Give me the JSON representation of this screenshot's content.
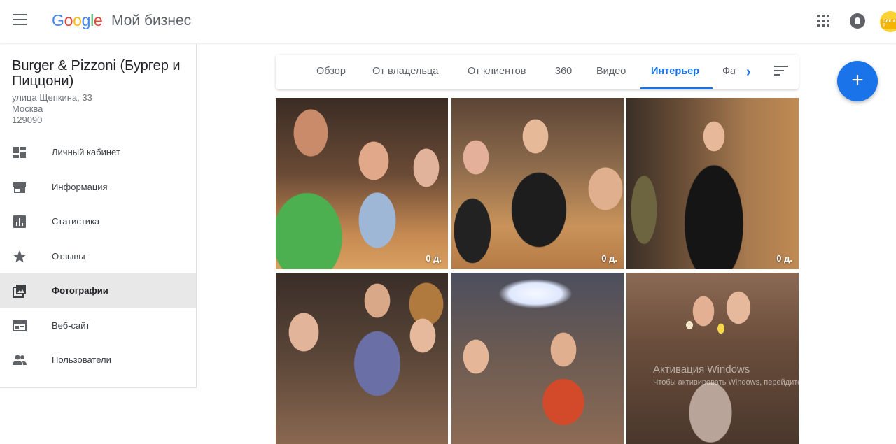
{
  "header": {
    "logo_letters": [
      "G",
      "o",
      "o",
      "g",
      "l",
      "e"
    ],
    "product": "Мой бизнес",
    "avatar_text": "GEE & P"
  },
  "business": {
    "name": "Burger & Pizzoni (Бургер и Пиццони)",
    "address_line1": "улица Щепкина, 33",
    "address_line2": "Москва",
    "postal_code": "129090"
  },
  "sidebar": {
    "items": [
      {
        "label": "Личный кабинет",
        "icon": "dashboard-icon"
      },
      {
        "label": "Информация",
        "icon": "store-icon"
      },
      {
        "label": "Статистика",
        "icon": "insights-icon"
      },
      {
        "label": "Отзывы",
        "icon": "star-icon"
      },
      {
        "label": "Фотографии",
        "icon": "photos-icon",
        "active": true
      },
      {
        "label": "Веб-сайт",
        "icon": "website-icon"
      },
      {
        "label": "Пользователи",
        "icon": "users-icon"
      }
    ]
  },
  "tabs": {
    "items": [
      "Обзор",
      "От владельца",
      "От клиентов",
      "360",
      "Видео",
      "Интерьер",
      "Фа"
    ],
    "active": "Интерьер"
  },
  "fab": {
    "label": "+"
  },
  "photos": [
    {
      "age": "0 д."
    },
    {
      "age": "0 д."
    },
    {
      "age": "0 д."
    },
    {
      "age": ""
    },
    {
      "age": ""
    },
    {
      "age": ""
    }
  ],
  "watermark": {
    "title": "Активация Windows",
    "subtitle": "Чтобы активировать Windows, перейдите к параметрам"
  },
  "colors": {
    "accent": "#1a73e8",
    "active_nav_bg": "#e8e8e8"
  }
}
